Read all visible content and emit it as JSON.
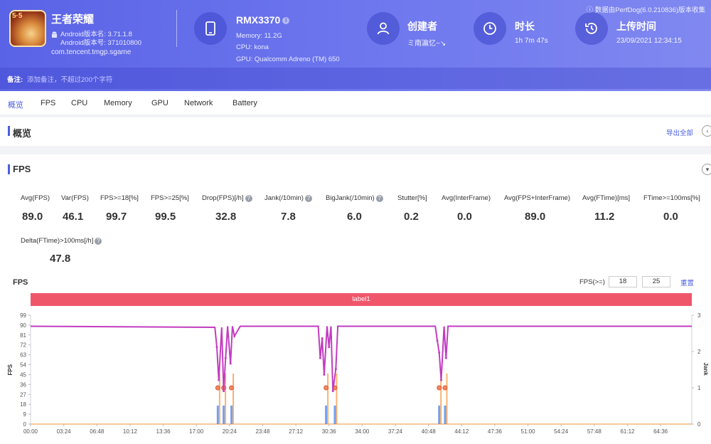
{
  "app": {
    "name": "王者荣耀",
    "android_version_name": "Android版本名: 3.71.1.8",
    "android_version_code": "Android版本号: 371010800",
    "package": "com.tencent.tmgp.sgame",
    "icon_badge": "5·5"
  },
  "device": {
    "model": "RMX3370",
    "memory": "Memory: 11.2G",
    "cpu": "CPU: kona",
    "gpu": "GPU: Qualcomm Adreno (TM) 650"
  },
  "creator": {
    "title": "创建者",
    "value": "ミ南瀛忆~↘"
  },
  "duration": {
    "title": "时长",
    "value": "1h 7m 47s"
  },
  "upload": {
    "title": "上传时间",
    "value": "23/09/2021 12:34:15"
  },
  "perfdog_note": "ⓘ 数据由PerfDog(6.0.210836)版本收集",
  "note": {
    "label": "备注:",
    "placeholder": "添加备注，不超过200个字符"
  },
  "tabs": [
    "概览",
    "FPS",
    "CPU",
    "Memory",
    "GPU",
    "Network",
    "Battery"
  ],
  "overview": {
    "title": "概览",
    "export": "导出全部"
  },
  "fps_section": {
    "title": "FPS"
  },
  "metrics": [
    {
      "label": "Avg(FPS)",
      "value": "89.0",
      "help": false
    },
    {
      "label": "Var(FPS)",
      "value": "46.1",
      "help": false
    },
    {
      "label": "FPS>=18[%]",
      "value": "99.7",
      "help": false
    },
    {
      "label": "FPS>=25[%]",
      "value": "99.5",
      "help": false
    },
    {
      "label": "Drop(FPS)[/h]",
      "value": "32.8",
      "help": true
    },
    {
      "label": "Jank(/10min)",
      "value": "7.8",
      "help": true
    },
    {
      "label": "BigJank(/10min)",
      "value": "6.0",
      "help": true
    },
    {
      "label": "Stutter[%]",
      "value": "0.2",
      "help": false
    },
    {
      "label": "Avg(InterFrame)",
      "value": "0.0",
      "help": false
    },
    {
      "label": "Avg(FPS+InterFrame)",
      "value": "89.0",
      "help": false
    },
    {
      "label": "Avg(FTime)[ms]",
      "value": "11.2",
      "help": false
    },
    {
      "label": "FTime>=100ms[%]",
      "value": "0.0",
      "help": false
    },
    {
      "label": "Delta(FTime)>100ms[/h]",
      "value": "47.8",
      "help": true
    }
  ],
  "fps_chart_controls": {
    "title": "FPS",
    "threshold_label": "FPS(>=)",
    "threshold_1": "18",
    "threshold_2": "25",
    "reset": "重置",
    "band_label": "label1"
  },
  "colors": {
    "accent": "#4a5fe0",
    "header_start": "#5a63e6",
    "fps_line": "#c23cc0",
    "jank_bar": "#5b8ff0",
    "jank_orange": "#f5a04a",
    "band": "#f0566a"
  },
  "chart_data": {
    "type": "line",
    "title": "",
    "xlabel": "",
    "ylabel": "FPS",
    "y2label": "Jank",
    "ylim": [
      0,
      99
    ],
    "y2lim": [
      0,
      3
    ],
    "yticks": [
      0,
      9,
      18,
      27,
      36,
      45,
      54,
      63,
      72,
      81,
      90,
      99
    ],
    "y2ticks": [
      0,
      1,
      2,
      3
    ],
    "x_ticks": [
      "00:00",
      "03:24",
      "06:48",
      "10:12",
      "13:36",
      "17:00",
      "20:24",
      "23:48",
      "27:12",
      "30:36",
      "34:00",
      "37:24",
      "40:48",
      "44:12",
      "47:36",
      "51:00",
      "54:24",
      "57:48",
      "61:12",
      "64:36"
    ],
    "series": [
      {
        "name": "FPS",
        "x_min": [
          0,
          18.9,
          19.1,
          19.3,
          19.6,
          19.8,
          20.0,
          20.2,
          20.5,
          20.7,
          20.9,
          21.5,
          21.7,
          29.5,
          29.7,
          29.9,
          30.1,
          30.4,
          30.6,
          30.8,
          31.0,
          31.3,
          31.5,
          31.9,
          41.5,
          41.7,
          41.9,
          42.1,
          42.4,
          42.6,
          42.8,
          67.8
        ],
        "y": [
          89,
          88,
          70,
          40,
          88,
          30,
          60,
          89,
          55,
          89,
          80,
          89,
          89,
          89,
          60,
          78,
          45,
          89,
          70,
          89,
          30,
          50,
          89,
          89,
          89,
          76,
          65,
          40,
          89,
          60,
          89,
          89
        ]
      },
      {
        "name": "Jank",
        "points": [
          [
            19.2,
            1
          ],
          [
            19.8,
            1
          ],
          [
            20.6,
            1
          ],
          [
            30.3,
            1
          ],
          [
            31.2,
            1
          ],
          [
            41.9,
            1
          ],
          [
            42.5,
            1
          ]
        ]
      }
    ]
  }
}
